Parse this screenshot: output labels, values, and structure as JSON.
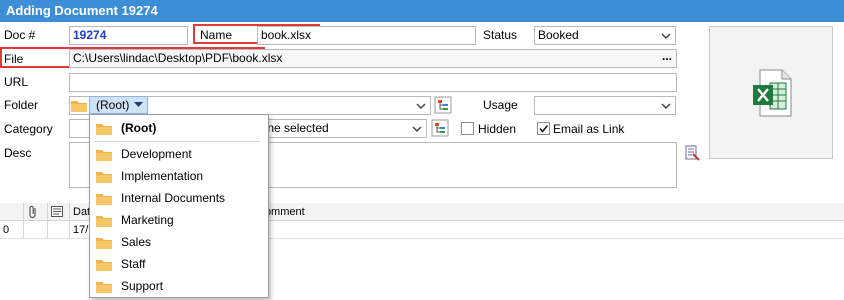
{
  "window": {
    "title": "Adding Document 19274"
  },
  "form": {
    "doc_label": "Doc #",
    "doc_value": "19274",
    "name_label": "Name",
    "name_value": "book.xlsx",
    "status_label": "Status",
    "status_value": "Booked",
    "file_label": "File",
    "file_value": "C:\\Users\\lindac\\Desktop\\PDF\\book.xlsx",
    "file_button": "...",
    "url_label": "URL",
    "url_value": "",
    "folder_label": "Folder",
    "folder_value": "(Root)",
    "usage_label": "Usage",
    "usage_value": "",
    "category_label": "Category",
    "category_value": "None selected",
    "hidden_label": "Hidden",
    "hidden_checked": false,
    "email_link_label": "Email as Link",
    "email_link_checked": true,
    "desc_label": "Desc",
    "desc_value": ""
  },
  "grid": {
    "columns": [
      "",
      "",
      "",
      "Date",
      "Comment"
    ],
    "rows": [
      {
        "num": "0",
        "date": "17/"
      }
    ]
  },
  "folder_dropdown": {
    "items": [
      "(Root)",
      "Development",
      "Implementation",
      "Internal Documents",
      "Marketing",
      "Sales",
      "Staff",
      "Support"
    ]
  },
  "colors": {
    "titlebar": "#3c8fd6",
    "doc_number": "#1c3fbf",
    "highlight_box": "#e03a3a",
    "folder_icon": "#f0b44a",
    "excel_green": "#1f7a3e"
  }
}
